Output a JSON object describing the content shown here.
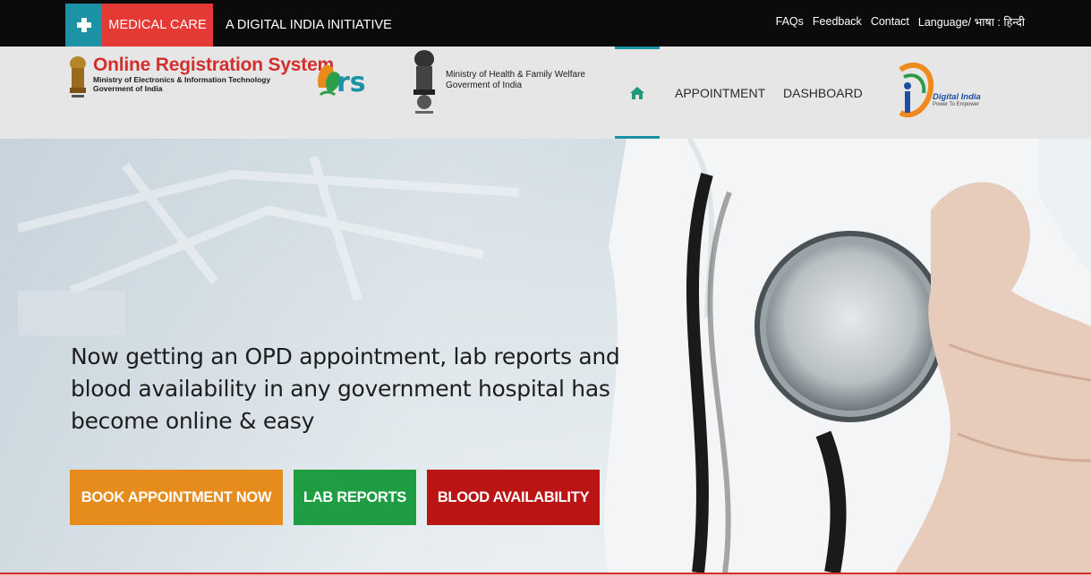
{
  "topbar": {
    "plus_icon": "plus-icon",
    "medical_care": "MEDICAL CARE",
    "initiative": "A DIGITAL INDIA INITIATIVE",
    "links": {
      "faqs": "FAQs",
      "feedback": "Feedback",
      "contact": "Contact",
      "language": "Language/ भाषा : हिन्दी"
    }
  },
  "header": {
    "ors_title": "Online Registration System",
    "ors_sub1": "Ministry of Electronics & Information Technology",
    "ors_sub2": "Goverment of India",
    "ors_logo_text": "rs",
    "mohfw_line1": "Ministry of Health & Family Welfare",
    "mohfw_line2": "Goverment of India",
    "nav": {
      "home_icon": "home-icon",
      "appointment": "APPOINTMENT",
      "dashboard": "DASHBOARD"
    },
    "digital_india": {
      "name": "Digital India",
      "tagline": "Power To Empower"
    }
  },
  "hero": {
    "headline": "Now getting an OPD appointment, lab reports and blood availability in any government hospital has become online & easy",
    "buttons": {
      "book": "BOOK APPOINTMENT NOW",
      "lab": "LAB REPORTS",
      "blood": "BLOOD AVAILABILITY"
    }
  },
  "colors": {
    "teal": "#1b93a4",
    "red": "#e53935",
    "orange": "#e58c1c",
    "green": "#1f9d42",
    "dark_red": "#bb1414"
  }
}
